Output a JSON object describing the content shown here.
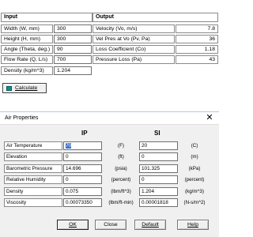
{
  "calc": {
    "input_header": "Input",
    "output_header": "Output",
    "inputs": [
      {
        "label": "Width (W, mm)",
        "value": "300"
      },
      {
        "label": "Height (H, mm)",
        "value": "300"
      },
      {
        "label": "Angle (Theta, deg.)",
        "value": "90"
      },
      {
        "label": "Flow Rate (Q, L/s)",
        "value": "700"
      },
      {
        "label": "Density (kg/m^3)",
        "value": "1.204"
      }
    ],
    "outputs": [
      {
        "label": "Velocity (Vo, m/s)",
        "value": "7.8"
      },
      {
        "label": "Vel Pres at Vo (Pv, Pa)",
        "value": "36"
      },
      {
        "label": "Loss Coefficient (Co)",
        "value": "1.18"
      },
      {
        "label": "Pressure Loss (Pa)",
        "value": "43"
      }
    ],
    "calculate_label": "Calculate"
  },
  "dialog": {
    "title": "Air Properties",
    "close_glyph": "✕",
    "col_ip": "IP",
    "col_si": "SI",
    "rows": [
      {
        "label": "Air Temperature",
        "ip": "70",
        "ip_unit": "(F)",
        "si": "20",
        "si_unit": "(C)"
      },
      {
        "label": "Elevation",
        "ip": "0",
        "ip_unit": "(ft)",
        "si": "0",
        "si_unit": "(m)"
      },
      {
        "label": "Barometric Pressure",
        "ip": "14.696",
        "ip_unit": "(psia)",
        "si": "101.325",
        "si_unit": "(kPa)"
      },
      {
        "label": "Relative Humidity",
        "ip": "0",
        "ip_unit": "(percent)",
        "si": "0",
        "si_unit": "(percent)"
      },
      {
        "label": "Density",
        "ip": "0.075",
        "ip_unit": "(lbm/ft^3)",
        "si": "1.204",
        "si_unit": "(kg/m^3)"
      },
      {
        "label": "Viscosity",
        "ip": "0.00073350",
        "ip_unit": "(lbm/ft-min)",
        "si": "0.00001818",
        "si_unit": "(N-s/m^2)"
      }
    ],
    "buttons": {
      "ok": "OK",
      "close": "Close",
      "default": "Default",
      "help": "Help"
    }
  }
}
